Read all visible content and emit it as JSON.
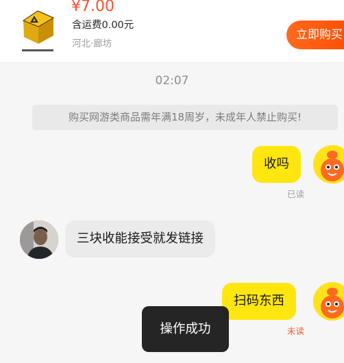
{
  "product": {
    "price": "¥7.00",
    "shipping": "含运费0.00元",
    "location": "河北·廊坊",
    "buy_button_label": "立即购买",
    "thumbnail_icon": "game-box-thumbnail"
  },
  "chat": {
    "time": "02:07",
    "notice": "购买网游类商品需年满18周岁，未成年人禁止购买!",
    "messages": [
      {
        "sender": "me",
        "text": "收吗",
        "status": "已读"
      },
      {
        "sender": "other",
        "text": "三块收能接受就发链接"
      },
      {
        "sender": "me",
        "text": "扫码东西",
        "status": "未读"
      }
    ]
  },
  "toast": {
    "text": "操作成功"
  },
  "colors": {
    "accent_orange": "#ff4a00",
    "price_red": "#ff4d2e",
    "bubble_yellow": "#ffe60f",
    "unread_red": "#ff5a2c"
  }
}
